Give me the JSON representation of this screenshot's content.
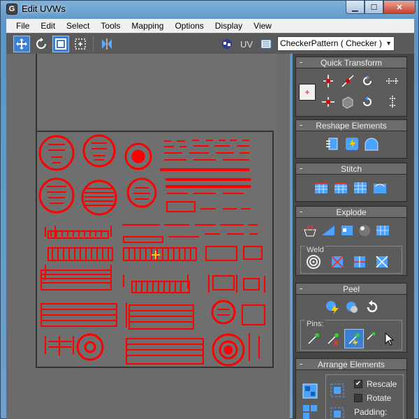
{
  "window": {
    "title": "Edit UVWs",
    "app_icon": "G"
  },
  "menu": [
    "File",
    "Edit",
    "Select",
    "Tools",
    "Mapping",
    "Options",
    "Display",
    "View"
  ],
  "toolbar": {
    "uv_label": "UV",
    "texture_select": "CheckerPattern  ( Checker )"
  },
  "panels": {
    "quick_transform": "Quick Transform",
    "reshape_elements": "Reshape Elements",
    "stitch": "Stitch",
    "explode": "Explode",
    "weld": "Weld",
    "peel": "Peel",
    "pins": "Pins:",
    "arrange_elements": "Arrange Elements",
    "rescale": "Rescale",
    "rotate": "Rotate",
    "padding": "Padding:"
  },
  "checkboxes": {
    "rescale_checked": true,
    "rotate_checked": false
  },
  "colors": {
    "uv_red": "#ff0000",
    "accent_blue": "#3f7fcf"
  }
}
